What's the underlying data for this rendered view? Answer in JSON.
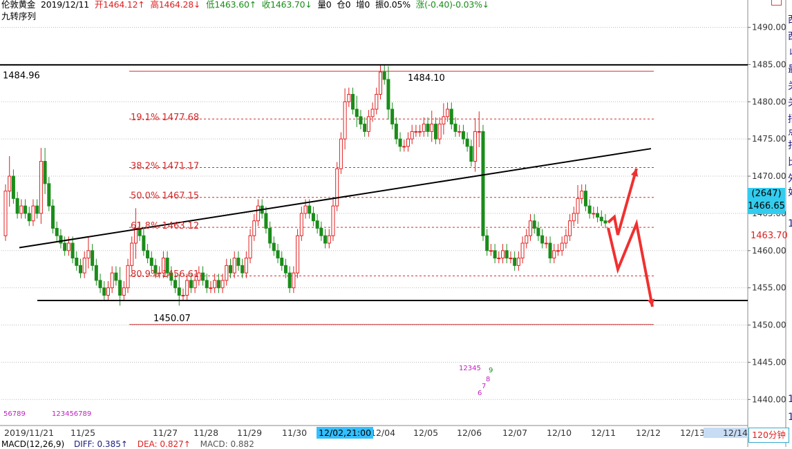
{
  "header": {
    "title": "伦敦黄金",
    "date": "2019/12/11",
    "open": "开1464.12↑",
    "high": "高1464.28↓",
    "low": "低1463.60↑",
    "close": "收1463.70↓",
    "volume": "量0",
    "open_interest": "仓0",
    "increase": "增0",
    "amplitude": "振0.05%",
    "change": "涨(-0.40)-0.03%↓",
    "indicator": "九转序列"
  },
  "colors": {
    "up": "#e02020",
    "down": "#1a8c1a",
    "fib": "#d42a2a",
    "grid": "#b8b8b8",
    "trend": "#000000",
    "arrow": "#f03030",
    "accent": "#33ccee",
    "nine_seq": "#c020c0"
  },
  "price_axis": {
    "ticks": [
      "1490.00",
      "1485.00",
      "1480.00",
      "1475.00",
      "1470.00",
      "1465.00",
      "1460.00",
      "1455.00",
      "1450.00",
      "1445.00",
      "1440.00"
    ],
    "partial": [
      "1",
      "1",
      "1"
    ],
    "current_count": "(2647)",
    "current_price": "1466.65",
    "last_price": "1463.70"
  },
  "annotations": {
    "high_level": "1484.96",
    "peak": "1484.10",
    "low": "1450.07",
    "fib": [
      "19.1% 1477.68",
      "38.2% 1471.17",
      "50.0% 1467.15",
      "61.8% 1463.12",
      "80.9% 1456.61"
    ]
  },
  "nine_sequence": {
    "left_a": "56789",
    "left_b": "123456789",
    "mid_a": "12345",
    "mid_b": "9",
    "mid_c": "8",
    "mid_d": "7",
    "mid_e": "6"
  },
  "date_axis": {
    "labels": [
      "2019/11/21",
      "11/25",
      "11/27",
      "11/28",
      "11/29",
      "11/30",
      "12/04",
      "12/05",
      "12/06",
      "12/07",
      "12/10",
      "12/11",
      "12/12",
      "12/13",
      "12/14"
    ],
    "selected": "12/02,21:00",
    "period": "120分钟"
  },
  "macd": {
    "title": "MACD(12,26,9)",
    "diff": "DIFF: 0.385↑",
    "dea": "DEA: 0.827↑",
    "macd": "MACD: 0.882"
  },
  "right_panel": {
    "chars": [
      "西",
      "西",
      "ㄐ",
      "最",
      "关",
      "关",
      "招",
      "点",
      "打",
      "比",
      "外",
      "如"
    ]
  },
  "chart_data": {
    "type": "candlestick",
    "y_range": [
      1436.5,
      1492.0
    ],
    "start": 1462.0,
    "closes": [
      1468,
      1470,
      1467,
      1465,
      1466,
      1465,
      1464,
      1466,
      1465,
      1472,
      1469,
      1466,
      1463,
      1462,
      1461,
      1460,
      1461,
      1459,
      1458,
      1457,
      1459,
      1460,
      1458,
      1456,
      1455,
      1454,
      1455,
      1457,
      1456,
      1454,
      1455,
      1458,
      1461,
      1463,
      1462,
      1460,
      1459,
      1458,
      1457,
      1457,
      1459,
      1457,
      1456,
      1455,
      1454,
      1454,
      1456,
      1455,
      1456,
      1457,
      1456,
      1455,
      1455,
      1456,
      1455,
      1456,
      1458,
      1457,
      1459,
      1458,
      1457,
      1459,
      1462,
      1464,
      1466,
      1465,
      1463,
      1461,
      1460,
      1459,
      1458,
      1457,
      1455,
      1457,
      1462,
      1465,
      1466,
      1465,
      1464,
      1463,
      1462,
      1461,
      1462,
      1466,
      1471,
      1475,
      1480,
      1481,
      1479,
      1478,
      1477,
      1476,
      1478,
      1479,
      1481,
      1484,
      1483,
      1479,
      1477,
      1475,
      1474,
      1474,
      1475,
      1476,
      1476,
      1476,
      1477,
      1476,
      1477,
      1475,
      1477,
      1478,
      1479,
      1477,
      1476,
      1476,
      1475,
      1474,
      1472,
      1476,
      1476,
      1462,
      1460,
      1460,
      1459,
      1459,
      1460,
      1459,
      1459,
      1458,
      1459,
      1461,
      1462,
      1464,
      1463,
      1462,
      1461,
      1461,
      1459,
      1460,
      1460,
      1461,
      1462,
      1464,
      1465,
      1467,
      1468,
      1466,
      1465,
      1465,
      1464.5,
      1464,
      1463.7
    ],
    "highs_extra": [
      1,
      3,
      1,
      1,
      1,
      1,
      1,
      1,
      1,
      2,
      2,
      1,
      1,
      1,
      1,
      1,
      1,
      1,
      1,
      1,
      1,
      2,
      1,
      1,
      1,
      1,
      1,
      1,
      1,
      2,
      1,
      1,
      1,
      3,
      1,
      1,
      1,
      1,
      1,
      1,
      1,
      1,
      1,
      1,
      2,
      1,
      1,
      1,
      1,
      1,
      1,
      1,
      1,
      1,
      1,
      1,
      1,
      1,
      1,
      1,
      1,
      1,
      1,
      1,
      1,
      1,
      1,
      1,
      1,
      1,
      1,
      1,
      1,
      1,
      1,
      1,
      1,
      1,
      1,
      1,
      1,
      1,
      1,
      1,
      1,
      1,
      2,
      1,
      1,
      2,
      1,
      1,
      1,
      1,
      1,
      1,
      1,
      2,
      1,
      1,
      1,
      1,
      1,
      1,
      1,
      1,
      1,
      1,
      2,
      1,
      1,
      2,
      1,
      1,
      1,
      1,
      1,
      1,
      1,
      2,
      3,
      1,
      1,
      1,
      1,
      1,
      1,
      1,
      1,
      1,
      1,
      1,
      1,
      1,
      1,
      1,
      1,
      1,
      1,
      1,
      1,
      1,
      1,
      1,
      1,
      2,
      1,
      1,
      1,
      1,
      1,
      1,
      1
    ]
  }
}
